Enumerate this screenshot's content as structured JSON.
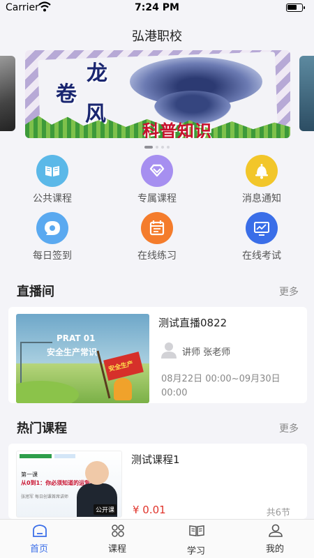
{
  "status_bar": {
    "carrier": "Carrier",
    "time": "7:24 PM"
  },
  "header": {
    "title": "弘港职校"
  },
  "banner": {
    "title_chars": [
      "龙",
      "卷",
      "风"
    ],
    "subtitle": "科普知识"
  },
  "features": [
    {
      "label": "公共课程",
      "icon": "book-icon",
      "color": "#5bb8e8"
    },
    {
      "label": "专属课程",
      "icon": "diamond-icon",
      "color": "#a68ff0"
    },
    {
      "label": "消息通知",
      "icon": "bell-icon",
      "color": "#f2c62a"
    },
    {
      "label": "每日签到",
      "icon": "chat-checkin-icon",
      "color": "#5aa9f0"
    },
    {
      "label": "在线练习",
      "icon": "calendar-icon",
      "color": "#f47c2c"
    },
    {
      "label": "在线考试",
      "icon": "monitor-chart-icon",
      "color": "#3a6ee8"
    }
  ],
  "live": {
    "section_title": "直播间",
    "more": "更多",
    "items": [
      {
        "title": "测试直播0822",
        "teacher": "讲师 张老师",
        "time": "08月22日 00:00~09月30日 00:00",
        "thumb_title": "PRAT 01",
        "thumb_subtitle": "安全生产常识",
        "thumb_flag": "安全生产"
      }
    ]
  },
  "hot": {
    "section_title": "热门课程",
    "more": "更多",
    "items": [
      {
        "title": "测试课程1",
        "price": "¥ 0.01",
        "lessons": "共6节",
        "thumb_line1": "第一课",
        "thumb_line2": "从0到1：你必须知道的运营战略",
        "thumb_line3": "张旭军  每日创课首席讲师",
        "thumb_tag": "公开课"
      }
    ]
  },
  "tabbar": [
    {
      "label": "首页",
      "icon": "home-icon",
      "active": true
    },
    {
      "label": "课程",
      "icon": "grid-icon",
      "active": false
    },
    {
      "label": "学习",
      "icon": "open-book-icon",
      "active": false
    },
    {
      "label": "我的",
      "icon": "person-icon",
      "active": false
    }
  ],
  "colors": {
    "accent": "#3a6ee8",
    "price": "#e0342b",
    "background": "#f4f4f8"
  }
}
